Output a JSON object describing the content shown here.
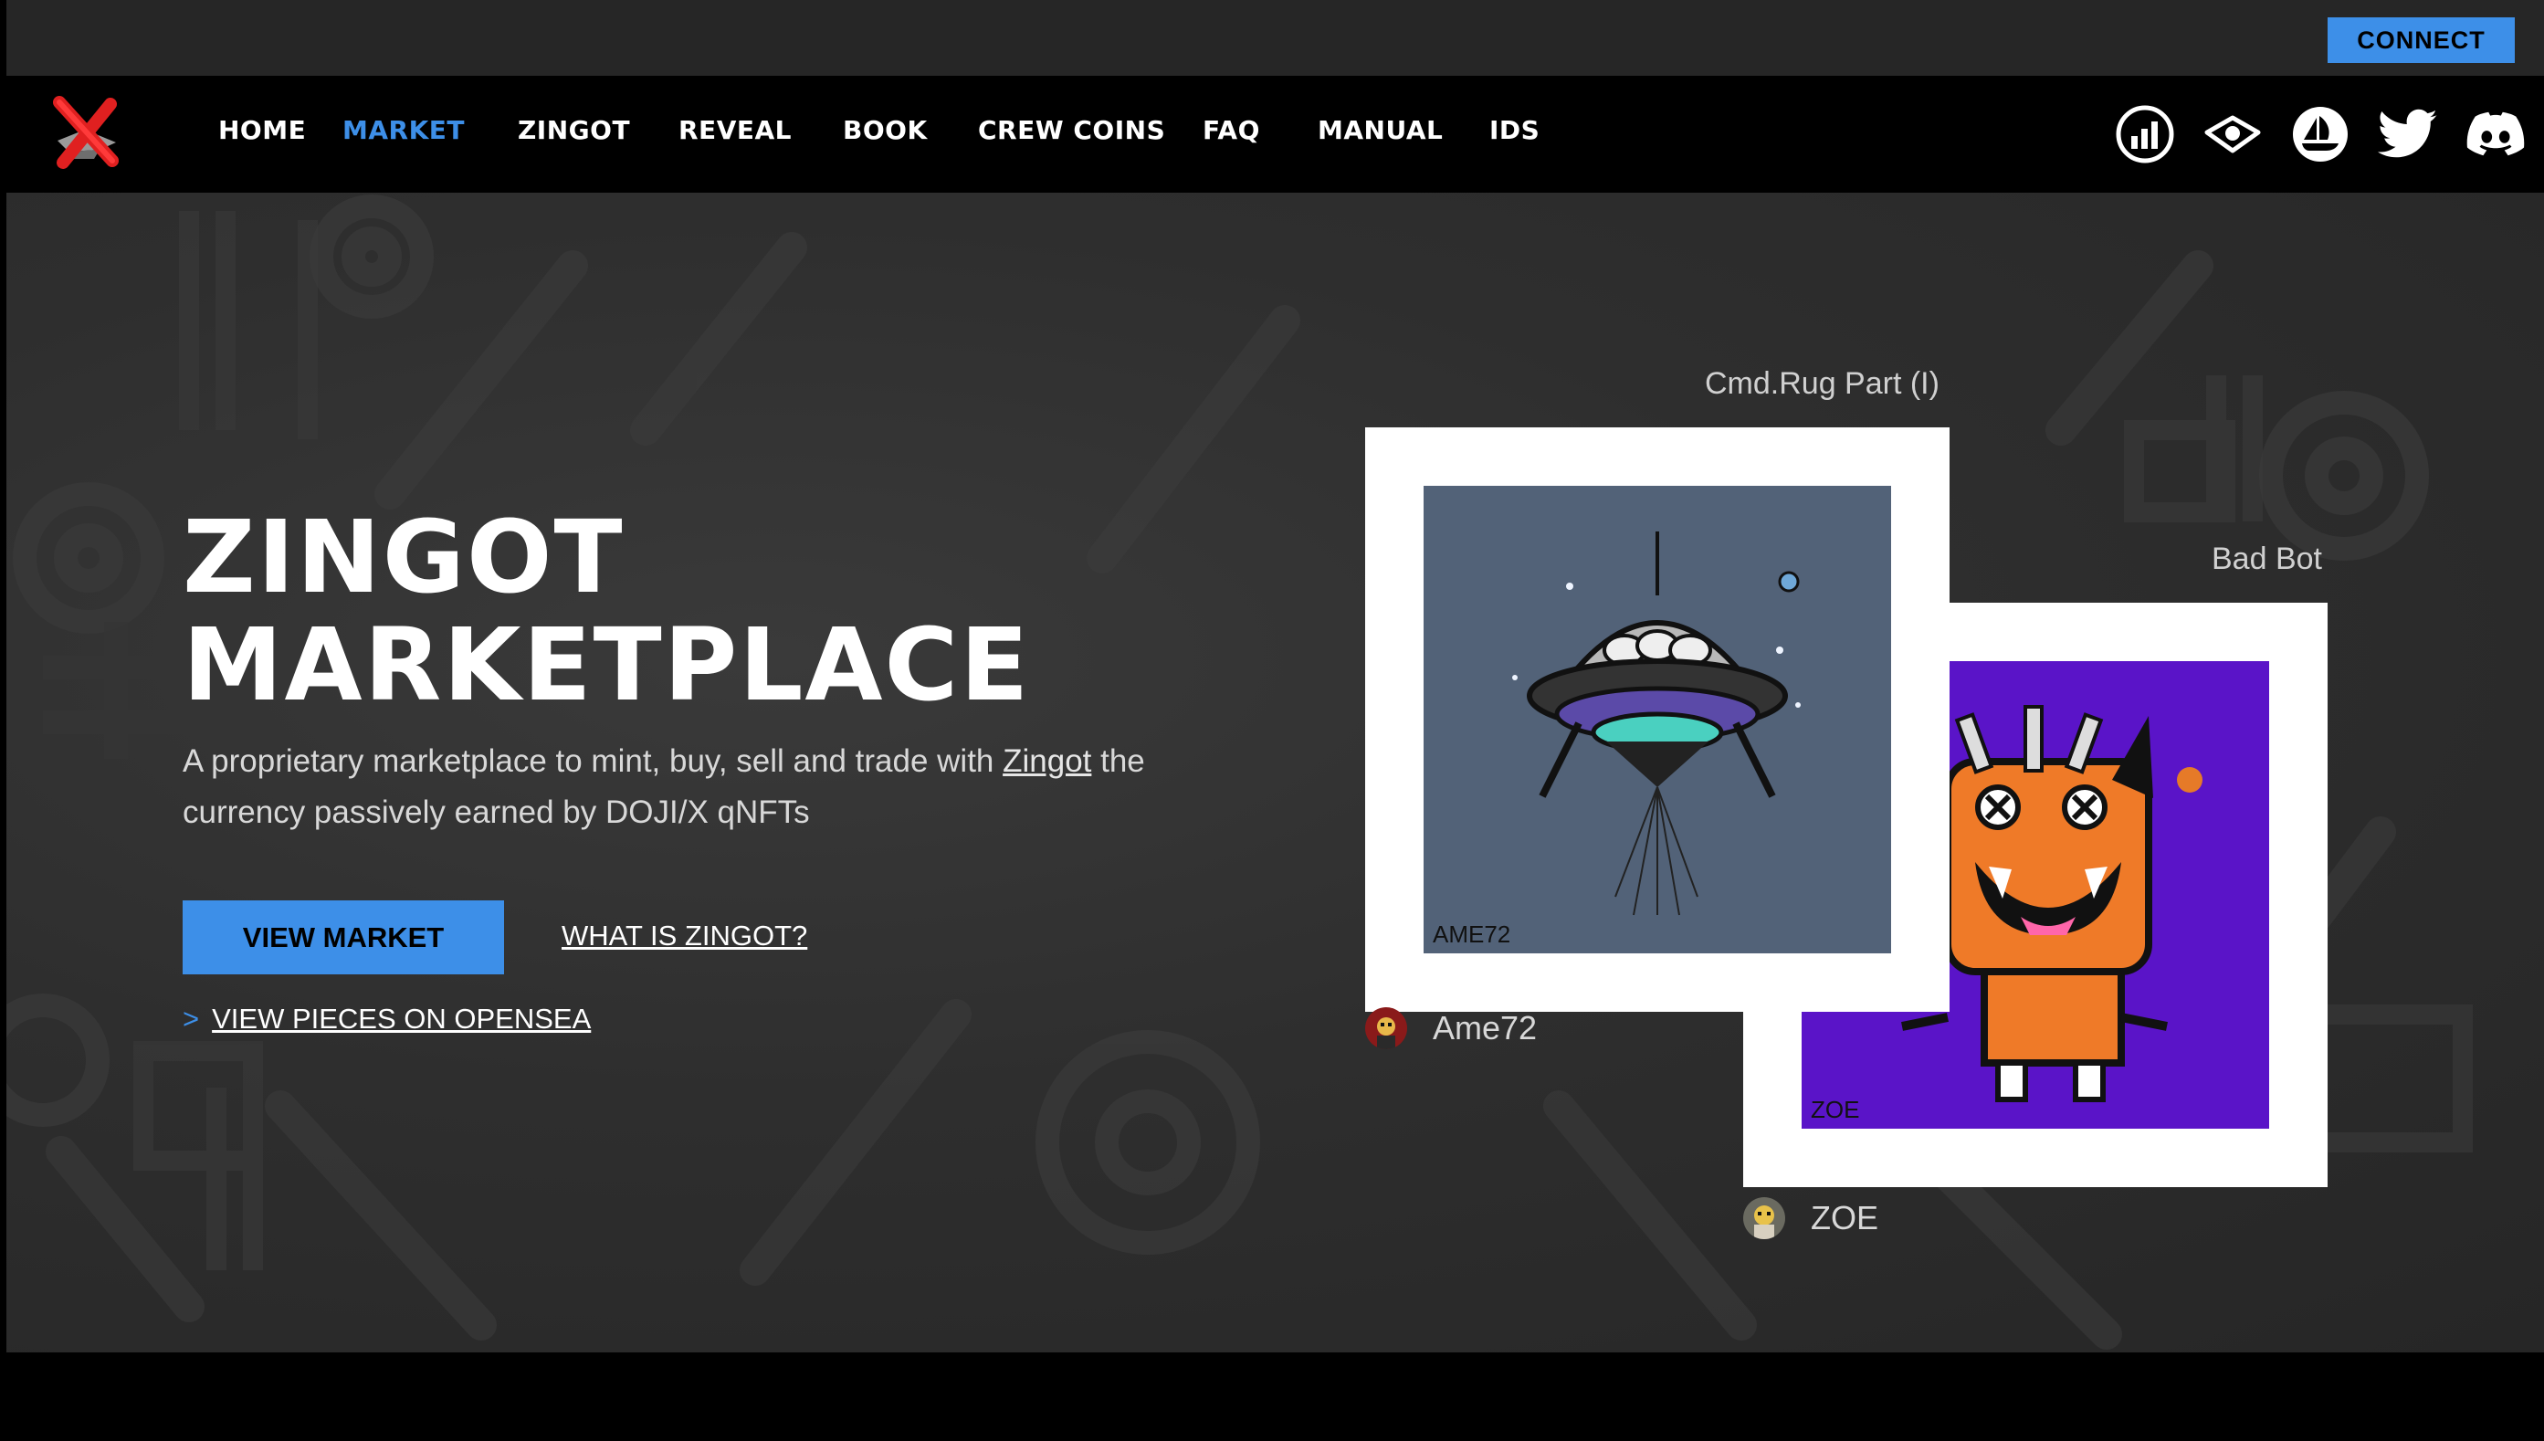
{
  "topbar": {
    "connect_label": "CONNECT"
  },
  "nav": {
    "items": [
      {
        "label": "HOME",
        "active": false
      },
      {
        "label": "MARKET",
        "active": true
      },
      {
        "label": "ZINGOT",
        "active": false
      },
      {
        "label": "REVEAL",
        "active": false
      },
      {
        "label": "BOOK",
        "active": false
      },
      {
        "label": "CREW COINS",
        "active": false
      },
      {
        "label": "FAQ",
        "active": false
      },
      {
        "label": "MANUAL",
        "active": false
      },
      {
        "label": "IDS",
        "active": false
      }
    ],
    "social_icons": [
      "chart-icon",
      "eye-icon",
      "opensea-icon",
      "twitter-icon",
      "discord-icon"
    ]
  },
  "hero": {
    "title_line1": "ZINGOT",
    "title_line2": "MARKETPLACE",
    "desc_before": "A proprietary marketplace to mint, buy, sell and trade with ",
    "desc_link": "Zingot",
    "desc_after": " the currency passively earned by DOJI/X qNFTs",
    "view_market_label": "VIEW MARKET",
    "what_is_label": "WHAT IS ZINGOT?",
    "opensea_arrow": ">",
    "opensea_label": "VIEW PIECES ON OPENSEA"
  },
  "cards": [
    {
      "title": "Cmd.Rug Part (I)",
      "creator": "Ame72",
      "art_bg": "#526278"
    },
    {
      "title": "Bad Bot",
      "creator": "ZOE",
      "art_bg": "#5a14c8"
    }
  ],
  "colors": {
    "accent": "#3d8fe8",
    "topbar": "#262626",
    "nav": "#000000"
  }
}
